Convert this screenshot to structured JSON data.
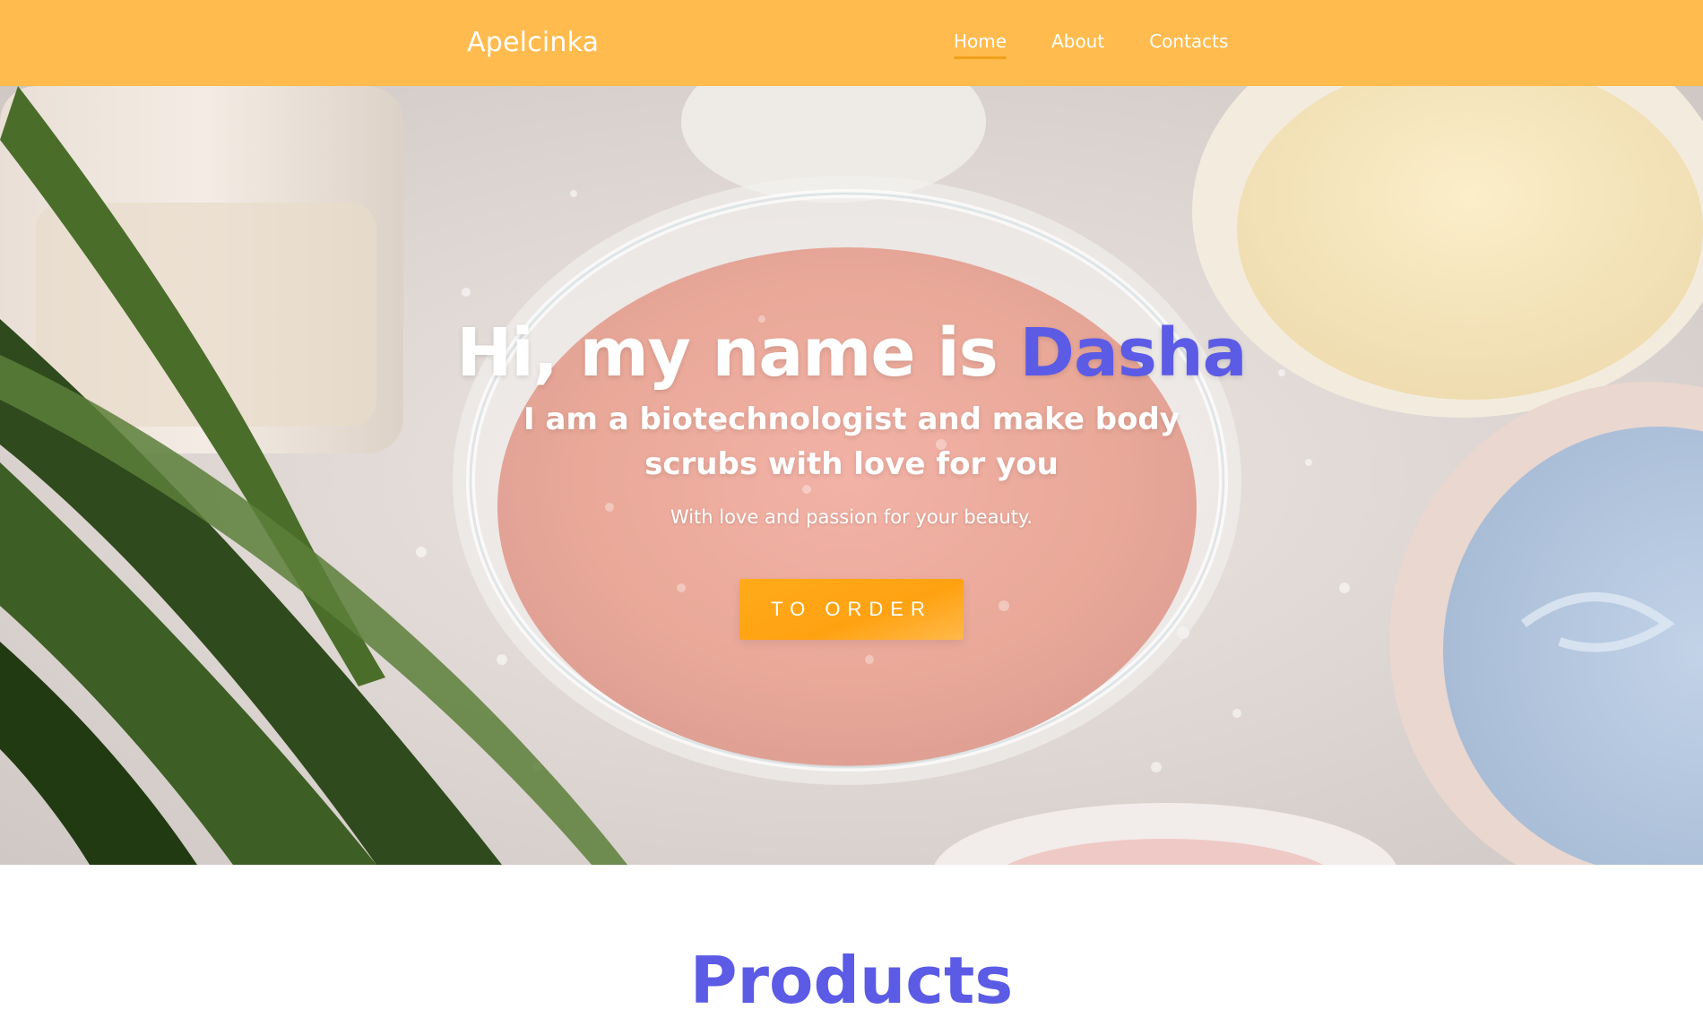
{
  "header": {
    "brand": "Apelcinka",
    "nav": [
      {
        "label": "Home",
        "active": true
      },
      {
        "label": "About",
        "active": false
      },
      {
        "label": "Contacts",
        "active": false
      }
    ]
  },
  "hero": {
    "title_prefix": "Hi, my name is ",
    "title_name": "Dasha",
    "subtitle": "I am a biotechnologist and make body scrubs with love for you",
    "tagline": "With love and passion for your beauty.",
    "cta_label": "TO ORDER"
  },
  "next_section": {
    "title": "Products"
  },
  "colors": {
    "header_bg": "#ffbb4d",
    "accent": "#5b5be6",
    "button_bg": "#ffa212",
    "text_light": "#ffffff"
  }
}
